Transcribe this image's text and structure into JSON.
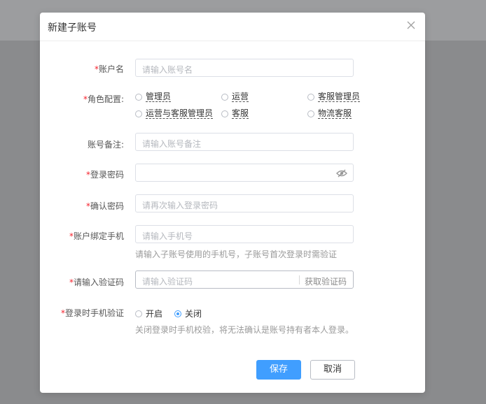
{
  "dialog": {
    "title": "新建子账号"
  },
  "form": {
    "account_name": {
      "label": "账户名",
      "required": "*",
      "placeholder": "请输入账号名"
    },
    "role": {
      "label": "角色配置:",
      "required": "*",
      "options": [
        "管理员",
        "运营",
        "客服管理员",
        "运营与客服管理员",
        "客服",
        "物流客服"
      ]
    },
    "remark": {
      "label": "账号备注:",
      "placeholder": "请输入账号备注"
    },
    "password": {
      "label": "登录密码",
      "required": "*"
    },
    "confirm_password": {
      "label": "确认密码",
      "required": "*",
      "placeholder": "请再次输入登录密码"
    },
    "phone": {
      "label": "账户绑定手机",
      "required": "*",
      "placeholder": "请输入手机号",
      "help": "请输入子账号使用的手机号，子账号首次登录时需验证"
    },
    "code": {
      "label": "请输入验证码",
      "required": "*",
      "placeholder": "请输入验证码",
      "button": "获取验证码"
    },
    "phone_verify": {
      "label": "登录时手机验证",
      "required": "*",
      "options": [
        "开启",
        "关闭"
      ],
      "selected": "关闭",
      "help": "关闭登录时手机校验，将无法确认是账号持有者本人登录。"
    }
  },
  "footer": {
    "save": "保存",
    "cancel": "取消"
  },
  "colors": {
    "primary": "#409eff",
    "required": "#f5222d"
  }
}
